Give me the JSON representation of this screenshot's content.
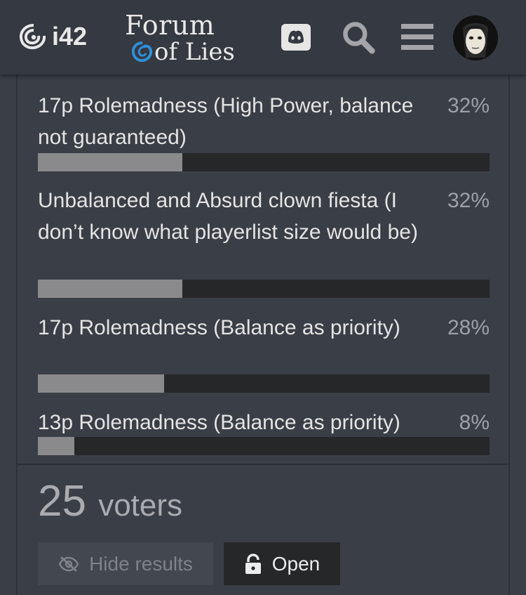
{
  "header": {
    "site_logo_text": "i42",
    "forum_title_line1": "Forum",
    "forum_title_line2": "of Lies",
    "icons": [
      "discord-icon",
      "search-icon",
      "hamburger-menu-icon",
      "user-avatar"
    ]
  },
  "poll": {
    "options": [
      {
        "label": "17p Rolemadness (High Power, balance not guaranteed)",
        "percent_label": "32%",
        "percent": 32
      },
      {
        "label": "Unbalanced and Absurd clown fiesta (I don’t know what playerlist size would be)",
        "percent_label": "32%",
        "percent": 32
      },
      {
        "label": "17p Rolemadness (Balance as priority)",
        "percent_label": "28%",
        "percent": 28
      },
      {
        "label": "13p Rolemadness (Balance as priority)",
        "percent_label": "8%",
        "percent": 8
      }
    ],
    "voters_count": "25",
    "voters_label": "voters",
    "hide_results_label": "Hide results",
    "open_label": "Open"
  },
  "colors": {
    "background": "#3a3e46",
    "header": "#353941",
    "bar_track": "#262729",
    "bar_fill": "#8a8a8c",
    "accent_blue": "#2f8fd8"
  }
}
